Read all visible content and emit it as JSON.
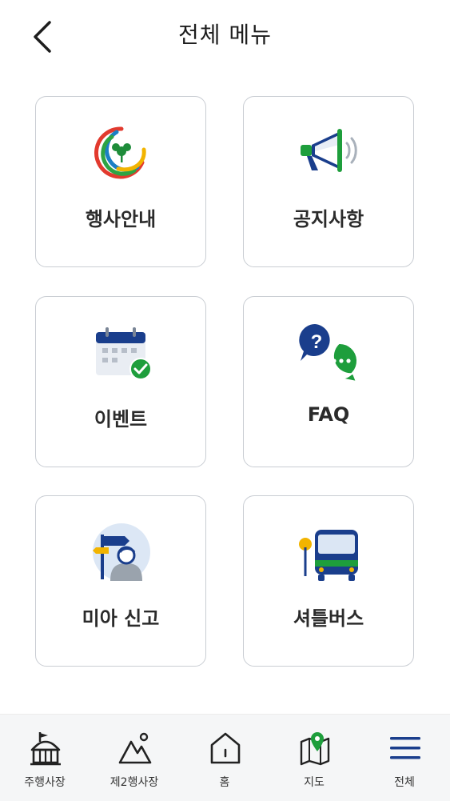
{
  "header": {
    "title": "전체 메뉴"
  },
  "menu": [
    {
      "label": "행사안내",
      "icon": "festival-logo-icon"
    },
    {
      "label": "공지사항",
      "icon": "megaphone-icon"
    },
    {
      "label": "이벤트",
      "icon": "calendar-check-icon"
    },
    {
      "label": "FAQ",
      "icon": "faq-chat-icon"
    },
    {
      "label": "미아 신고",
      "icon": "lost-child-icon"
    },
    {
      "label": "셔틀버스",
      "icon": "bus-icon"
    }
  ],
  "tabbar": [
    {
      "label": "주행사장",
      "icon": "main-venue-icon"
    },
    {
      "label": "제2행사장",
      "icon": "mountain-icon"
    },
    {
      "label": "홈",
      "icon": "home-icon"
    },
    {
      "label": "지도",
      "icon": "map-pin-icon"
    },
    {
      "label": "전체",
      "icon": "hamburger-menu-icon",
      "active": true
    }
  ],
  "colors": {
    "accent_blue": "#1a3e8c",
    "green": "#1e9e3c",
    "border": "#c9cdd3"
  }
}
